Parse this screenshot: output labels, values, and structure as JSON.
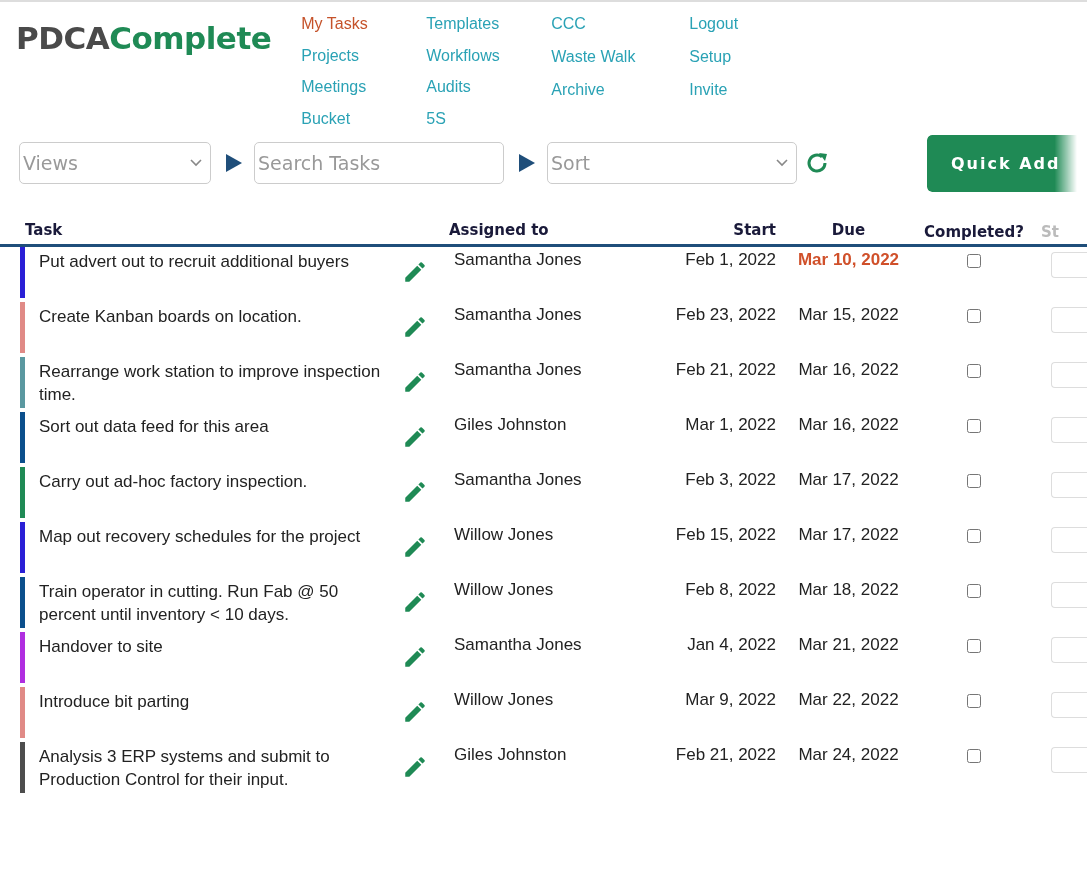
{
  "logo": {
    "part_1": "PDCA",
    "part_2": "Complete"
  },
  "nav": [
    [
      {
        "label": "My Tasks",
        "selected": true
      },
      {
        "label": "Projects",
        "selected": false
      },
      {
        "label": "Meetings",
        "selected": false
      },
      {
        "label": "Bucket",
        "selected": false
      }
    ],
    [
      {
        "label": "Templates",
        "selected": false
      },
      {
        "label": "Workflows",
        "selected": false
      },
      {
        "label": "Audits",
        "selected": false
      },
      {
        "label": "5S",
        "selected": false
      }
    ],
    [
      {
        "label": "CCC",
        "selected": false
      },
      {
        "label": "Waste Walk",
        "selected": false
      },
      {
        "label": "Archive",
        "selected": false
      }
    ],
    [
      {
        "label": "Logout",
        "selected": false
      },
      {
        "label": "Setup",
        "selected": false
      },
      {
        "label": "Invite",
        "selected": false
      }
    ]
  ],
  "toolbar": {
    "views": {
      "placeholder": "Views"
    },
    "search": {
      "placeholder": "Search Tasks"
    },
    "sort": {
      "placeholder": "Sort"
    },
    "quick_add": "Quick Add"
  },
  "table": {
    "columns": [
      "Task",
      "Assigned to",
      "Start",
      "Due",
      "Completed?",
      "St"
    ],
    "rows": [
      {
        "task": "Put advert out to recruit additional buyers",
        "color": "#2a1fd6",
        "assigned": "Samantha Jones",
        "start": "Feb 1, 2022",
        "due": "Mar 10, 2022",
        "overdue": true,
        "checked": false
      },
      {
        "task": "Create Kanban boards on location.",
        "color": "#e08a86",
        "assigned": "Samantha Jones",
        "start": "Feb 23, 2022",
        "due": "Mar 15, 2022",
        "overdue": false,
        "checked": false
      },
      {
        "task": "Rearrange work station to improve inspection time.",
        "color": "#5a98a0",
        "assigned": "Samantha Jones",
        "start": "Feb 21, 2022",
        "due": "Mar 16, 2022",
        "overdue": false,
        "checked": false
      },
      {
        "task": "Sort out data feed for this area",
        "color": "#0b4f8c",
        "assigned": "Giles Johnston",
        "start": "Mar 1, 2022",
        "due": "Mar 16, 2022",
        "overdue": false,
        "checked": false
      },
      {
        "task": "Carry out ad-hoc factory inspection.",
        "color": "#1f8a55",
        "assigned": "Samantha Jones",
        "start": "Feb 3, 2022",
        "due": "Mar 17, 2022",
        "overdue": false,
        "checked": false
      },
      {
        "task": "Map out recovery schedules for the project",
        "color": "#2a1fd6",
        "assigned": "Willow Jones",
        "start": "Feb 15, 2022",
        "due": "Mar 17, 2022",
        "overdue": false,
        "checked": false
      },
      {
        "task": "Train operator in cutting. Run Fab @ 50 percent until inventory < 10 days.",
        "color": "#0b4f8c",
        "assigned": "Willow Jones",
        "start": "Feb 8, 2022",
        "due": "Mar 18, 2022",
        "overdue": false,
        "checked": false
      },
      {
        "task": "Handover to site",
        "color": "#b02ee0",
        "assigned": "Samantha Jones",
        "start": "Jan 4, 2022",
        "due": "Mar 21, 2022",
        "overdue": false,
        "checked": false
      },
      {
        "task": "Introduce bit parting",
        "color": "#e08a86",
        "assigned": "Willow Jones",
        "start": "Mar 9, 2022",
        "due": "Mar 22, 2022",
        "overdue": false,
        "checked": false
      },
      {
        "task": "Analysis 3 ERP systems and submit to Production Control for their input.",
        "color": "#4d4d4d",
        "assigned": "Giles Johnston",
        "start": "Feb 21, 2022",
        "due": "Mar 24, 2022",
        "overdue": false,
        "checked": false
      }
    ]
  }
}
